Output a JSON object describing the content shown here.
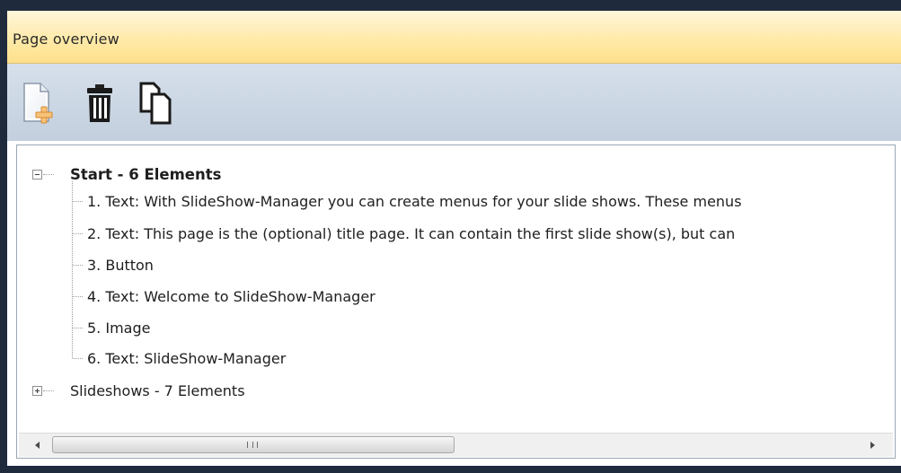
{
  "panel": {
    "title": "Page overview"
  },
  "toolbar": {
    "buttons": [
      {
        "icon": "add-page-icon"
      },
      {
        "icon": "trash-icon"
      },
      {
        "icon": "copy-page-icon"
      }
    ]
  },
  "tree": {
    "nodes": [
      {
        "label": "Start - 6 Elements",
        "expanded": true,
        "children": [
          {
            "label": "1. Text: With SlideShow-Manager you can create menus for your slide shows. These menus"
          },
          {
            "label": "2. Text: This page is the (optional) title page. It can contain the first slide show(s), but can"
          },
          {
            "label": "3. Button"
          },
          {
            "label": "4. Text: Welcome to SlideShow-Manager"
          },
          {
            "label": "5. Image"
          },
          {
            "label": "6. Text: SlideShow-Manager"
          }
        ]
      },
      {
        "label": "Slideshows - 7 Elements",
        "expanded": false
      }
    ]
  },
  "scrollbar": {
    "grip": "III"
  }
}
